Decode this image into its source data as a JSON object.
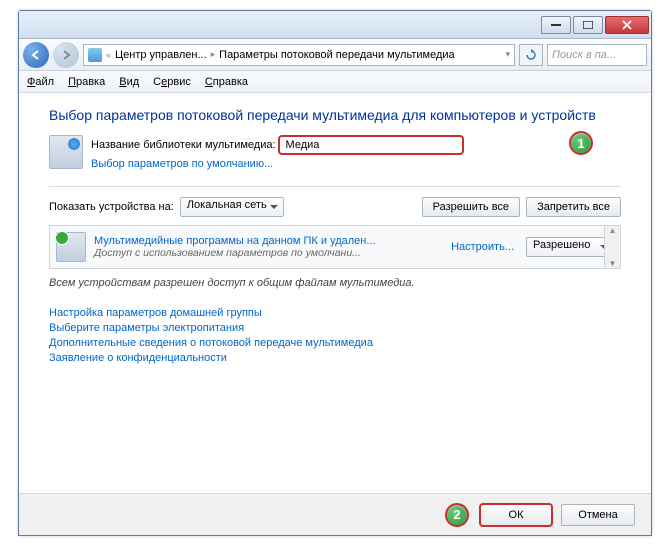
{
  "titlebar": {
    "min": "_",
    "max": "□",
    "close": "×"
  },
  "nav": {
    "crumb1": "Центр управлен...",
    "crumb2": "Параметры потоковой передачи мультимедиа",
    "search_placeholder": "Поиск в па..."
  },
  "menu": {
    "file": "Файл",
    "edit": "Правка",
    "view": "Вид",
    "tools": "Сервис",
    "help": "Справка"
  },
  "heading": "Выбор параметров потоковой передачи мультимедиа для компьютеров и устройств",
  "library": {
    "label": "Название библиотеки мультимедиа:",
    "value": "Медиа",
    "defaults_link": "Выбор параметров по умолчанию..."
  },
  "show": {
    "label": "Показать устройства на:",
    "scope": "Локальная сеть",
    "allow_all": "Разрешить все",
    "block_all": "Запретить все"
  },
  "device": {
    "title": "Мультимедийные программы на данном ПК и удален...",
    "subtitle": "Доступ с использованием параметров по умолчани...",
    "customize": "Настроить...",
    "state": "Разрешено"
  },
  "status": "Всем устройствам разрешен доступ к общим файлам мультимедиа.",
  "links": {
    "l1": "Настройка параметров домашней группы",
    "l2": "Выберите параметры электропитания",
    "l3": "Дополнительные сведения о потоковой передаче мультимедиа",
    "l4": "Заявление о конфиденциальности"
  },
  "footer": {
    "ok": "ОК",
    "cancel": "Отмена"
  },
  "badges": {
    "b1": "1",
    "b2": "2"
  }
}
